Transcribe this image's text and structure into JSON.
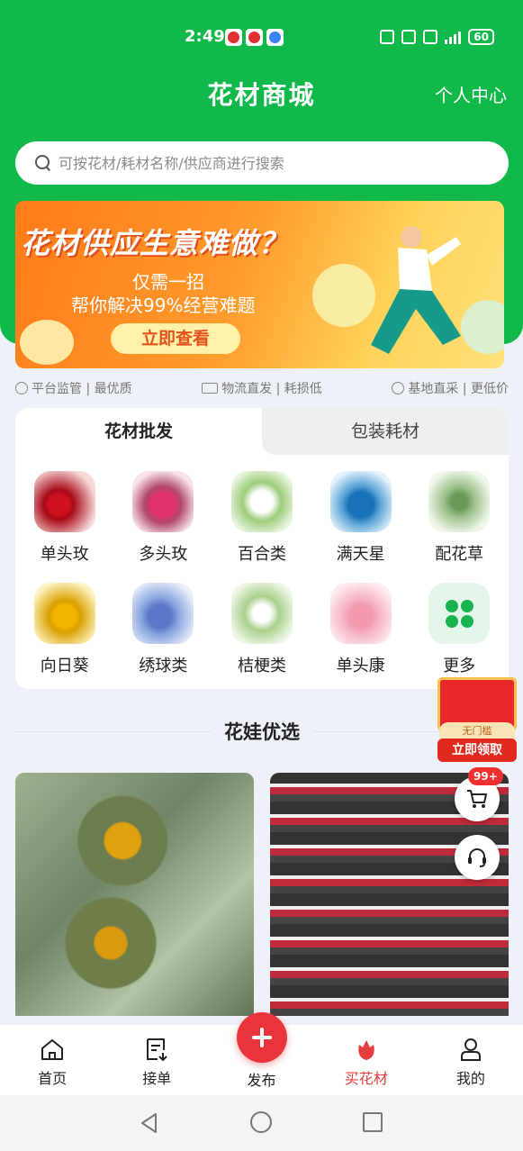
{
  "statusbar": {
    "time": "2:49",
    "battery": "60"
  },
  "header": {
    "title": "花材商城",
    "personal": "个人中心"
  },
  "search": {
    "placeholder": "可按花材/耗材名称/供应商进行搜索"
  },
  "banner": {
    "headline": "花材供应生意难做？",
    "line1": "仅需一招",
    "line2": "帮你解决99%经营难题",
    "cta": "立即查看"
  },
  "features": [
    {
      "text": "平台监管 | 最优质",
      "icon": "shield-icon"
    },
    {
      "text": "物流直发 | 耗损低",
      "icon": "truck-icon"
    },
    {
      "text": "基地直采 | 更低价",
      "icon": "tag-icon"
    }
  ],
  "tabs": [
    {
      "label": "花材批发",
      "active": true
    },
    {
      "label": "包装耗材",
      "active": false
    }
  ],
  "categories": [
    {
      "label": "单头玫",
      "icon": "rose"
    },
    {
      "label": "多头玫",
      "icon": "spray"
    },
    {
      "label": "百合类",
      "icon": "lily"
    },
    {
      "label": "满天星",
      "icon": "gyp"
    },
    {
      "label": "配花草",
      "icon": "fern"
    },
    {
      "label": "向日葵",
      "icon": "sun"
    },
    {
      "label": "绣球类",
      "icon": "hyd"
    },
    {
      "label": "桔梗类",
      "icon": "bell"
    },
    {
      "label": "单头康",
      "icon": "carn"
    },
    {
      "label": "更多",
      "icon": "more"
    }
  ],
  "section": {
    "title": "花娃优选"
  },
  "promo": {
    "label": "无门槛",
    "button": "立即领取"
  },
  "cart_badge": "99+",
  "bottomnav": {
    "items": [
      {
        "label": "首页",
        "icon": "home-icon"
      },
      {
        "label": "接单",
        "icon": "order-icon"
      },
      {
        "label": "发布",
        "icon": "plus-icon"
      },
      {
        "label": "买花材",
        "icon": "flower-icon",
        "active": true
      },
      {
        "label": "我的",
        "icon": "user-icon"
      }
    ]
  },
  "colors": {
    "brand": "#10b94a",
    "accent": "#e43d3d"
  }
}
